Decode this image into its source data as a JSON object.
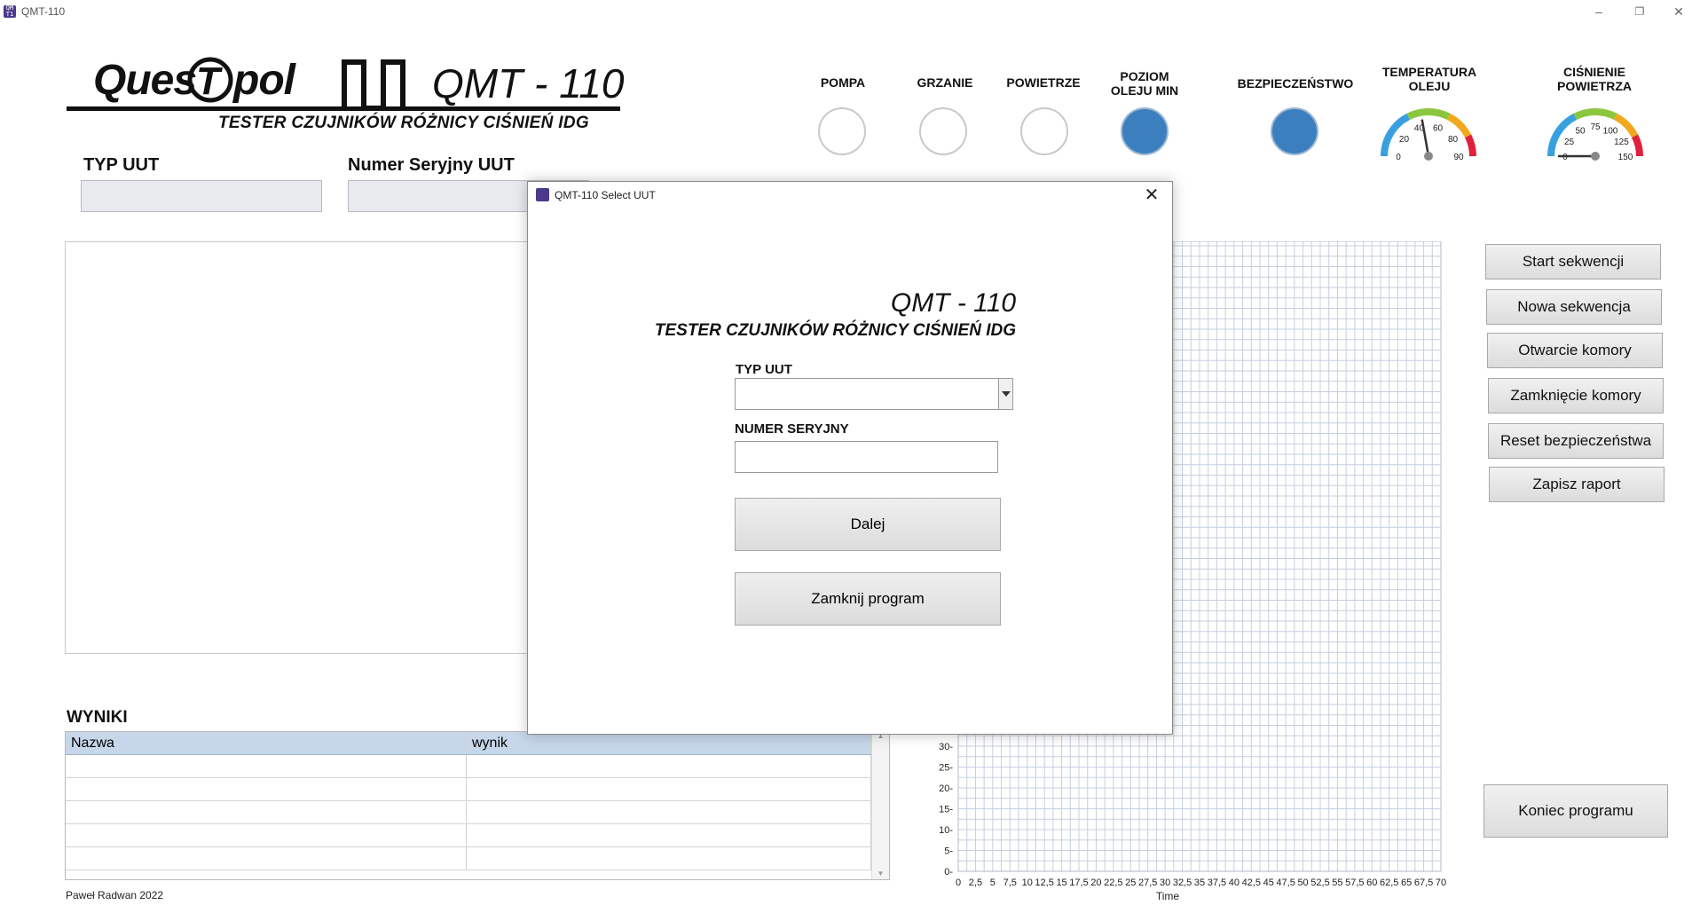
{
  "window": {
    "title": "QMT-110",
    "icon": "app-icon",
    "controls": [
      "minimize-icon",
      "restore-icon",
      "close-icon"
    ]
  },
  "header": {
    "logo": "Ques Tpol",
    "model": "QMT - 110",
    "subtitle": "TESTER CZUJNIKÓW RÓŻNICY CIŚNIEŃ IDG"
  },
  "fields": {
    "typ_uut_label": "TYP UUT",
    "typ_uut_value": "",
    "serial_label": "Numer Seryjny UUT",
    "serial_value": ""
  },
  "indicators": [
    {
      "label": "POMPA",
      "on": false
    },
    {
      "label": "GRZANIE",
      "on": false
    },
    {
      "label": "POWIETRZE",
      "on": false
    },
    {
      "label_line1": "POZIOM",
      "label_line2": "OLEJU MIN",
      "on": true
    },
    {
      "label": "BEZPIECZEŃSTWO",
      "on": true
    }
  ],
  "gauges": {
    "temperature": {
      "label_line1": "TEMPERATURA",
      "label_line2": "OLEJU",
      "ticks": [
        "0",
        "20",
        "40",
        "60",
        "80",
        "90"
      ],
      "value": 40,
      "min": 0,
      "max": 90
    },
    "pressure": {
      "label_line1": "CIŚNIENIE",
      "label_line2": "POWIETRZA",
      "ticks": [
        "0",
        "25",
        "50",
        "75",
        "100",
        "125",
        "150"
      ],
      "value": 0,
      "min": 0,
      "max": 150
    },
    "colors": {
      "cold": "#39a0e0",
      "ok": "#8cc63f",
      "warn": "#f2a81d",
      "hot": "#e0203c"
    }
  },
  "buttons": {
    "start": "Start sekwencji",
    "new": "Nowa sekwencja",
    "open": "Otwarcie komory",
    "close": "Zamknięcie komory",
    "reset": "Reset bezpieczeństwa",
    "save": "Zapisz raport",
    "exit": "Koniec programu"
  },
  "results": {
    "title": "WYNIKI",
    "columns": [
      "Nazwa",
      "wynik"
    ],
    "rows": 5
  },
  "footer": {
    "author": "Paweł Radwan 2022"
  },
  "chart_data": {
    "type": "line",
    "xlabel": "Time",
    "ylabel": "",
    "x_ticks": [
      "0",
      "2,5",
      "5",
      "7,5",
      "10",
      "12,5",
      "15",
      "17,5",
      "20",
      "22,5",
      "25",
      "27,5",
      "30",
      "32,5",
      "35",
      "37,5",
      "40",
      "42,5",
      "45",
      "47,5",
      "50",
      "52,5",
      "55",
      "57,5",
      "60",
      "62,5",
      "65",
      "67,5",
      "70"
    ],
    "y_ticks": [
      "0",
      "5",
      "10",
      "15",
      "20",
      "25",
      "30"
    ],
    "xlim": [
      0,
      70
    ],
    "grid": true,
    "series": []
  },
  "modal": {
    "title": "QMT-110 Select UUT",
    "model": "QMT - 110",
    "subtitle": "TESTER CZUJNIKÓW RÓŻNICY CIŚNIEŃ IDG",
    "typ_label": "TYP UUT",
    "typ_value": "",
    "serial_label": "NUMER SERYJNY",
    "serial_value": "",
    "next_button": "Dalej",
    "close_button": "Zamknij program"
  }
}
